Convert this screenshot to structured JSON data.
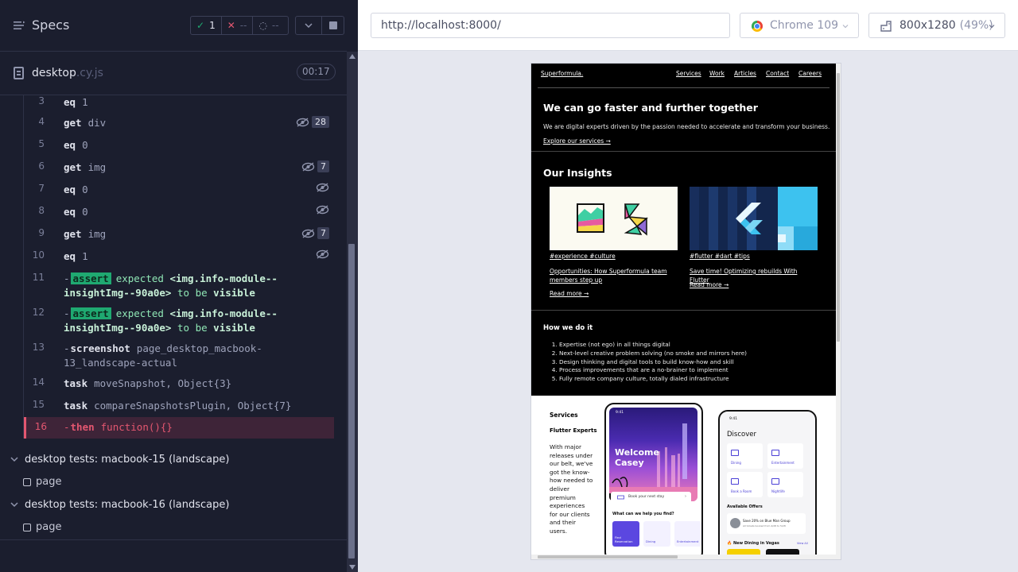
{
  "reporter": {
    "title": "Specs",
    "stats": {
      "passed": "1",
      "failed": "--",
      "pending": "--"
    },
    "file": {
      "name": "desktop",
      "ext": ".cy.js",
      "duration": "00:17"
    },
    "commands": [
      {
        "num": "3",
        "name": "eq",
        "arg": "1"
      },
      {
        "num": "4",
        "name": "get",
        "arg": "div",
        "count": "28"
      },
      {
        "num": "5",
        "name": "eq",
        "arg": "0"
      },
      {
        "num": "6",
        "name": "get",
        "arg": "img",
        "count": "7"
      },
      {
        "num": "7",
        "name": "eq",
        "arg": "0"
      },
      {
        "num": "8",
        "name": "eq",
        "arg": "0"
      },
      {
        "num": "9",
        "name": "get",
        "arg": "img",
        "count": "7"
      },
      {
        "num": "10",
        "name": "eq",
        "arg": "1"
      },
      {
        "num": "11",
        "prefix": "-",
        "badge": "assert",
        "expected": "expected",
        "code_line1": "<img.info-module--",
        "code_line2": "insightImg--90a0e>",
        "to_be": "to be",
        "visible": "visible"
      },
      {
        "num": "12",
        "prefix": "-",
        "badge": "assert",
        "expected": "expected",
        "code_line1": "<img.info-module--",
        "code_line2": "insightImg--90a0e>",
        "to_be": "to be",
        "visible": "visible"
      },
      {
        "num": "13",
        "prefix": "-",
        "name": "screenshot",
        "arg_line1": "page_desktop_macbook-",
        "arg_line2": "13_landscape-actual"
      },
      {
        "num": "14",
        "name": "task",
        "arg": "moveSnapshot, Object{3}"
      },
      {
        "num": "15",
        "name": "task",
        "arg": "compareSnapshotsPlugin, Object{7}"
      },
      {
        "num": "16",
        "prefix": "-",
        "name": "then",
        "arg": "function(){}"
      }
    ],
    "suites": [
      {
        "title": "desktop tests: macbook-15 (landscape)",
        "test": "page"
      },
      {
        "title": "desktop tests: macbook-16 (landscape)",
        "test": "page"
      }
    ]
  },
  "aut": {
    "url": "http://localhost:8000/",
    "browser": "Chrome 109",
    "viewport": "800x1280",
    "scale": "(49%)"
  },
  "site": {
    "logo": "Superformula.",
    "nav": [
      "Services",
      "Work",
      "Articles",
      "Contact",
      "Careers"
    ],
    "hero": {
      "title": "We can go faster and further together",
      "subtitle": "We are digital experts driven by the passion needed to accelerate and transform your business.",
      "link": "Explore our services →"
    },
    "insights": {
      "title": "Our Insights",
      "cards": [
        {
          "tags": "#experience #culture",
          "title": "Opportunities: How Superformula team members step up",
          "more": "Read more →"
        },
        {
          "tags": "#flutter #dart #tips",
          "title": "Save time! Optimizing rebuilds With Flutter",
          "more": "Read more →"
        }
      ]
    },
    "how": {
      "title": "How we do it",
      "items": [
        "Expertise (not ego) in all things digital",
        "Next-level creative problem solving (no smoke and mirrors here)",
        "Design thinking and digital tools to build know-how and skill",
        "Process improvements that are a no-brainer to implement",
        "Fully remote company culture, totally dialed infrastructure"
      ]
    },
    "services": {
      "title": "Services",
      "subtitle": "Flutter Experts",
      "description": "With major releases under our belt, we've got the know-how needed to deliver premium experiences for our clients and their users.",
      "phone1": {
        "time": "9:41",
        "welcome_line1": "Welcome",
        "welcome_line2": "Casey",
        "book": "Book your next stay",
        "help": "What can we help you find?",
        "tiles": [
          "Find Reservation",
          "Dining",
          "Entertainment"
        ]
      },
      "phone2": {
        "time": "9:41",
        "title": "Discover",
        "tiles": [
          "Dining",
          "Entertainment",
          "Book a Room",
          "Nightlife"
        ],
        "offers_title": "Available Offers",
        "offer_title": "Save 20% on Blue Man Group",
        "offer_sub": "All tickets booked from 4/28 to 5/28",
        "new_dining": "🔥 New Dining in Vegas",
        "view_all": "View All"
      }
    }
  }
}
